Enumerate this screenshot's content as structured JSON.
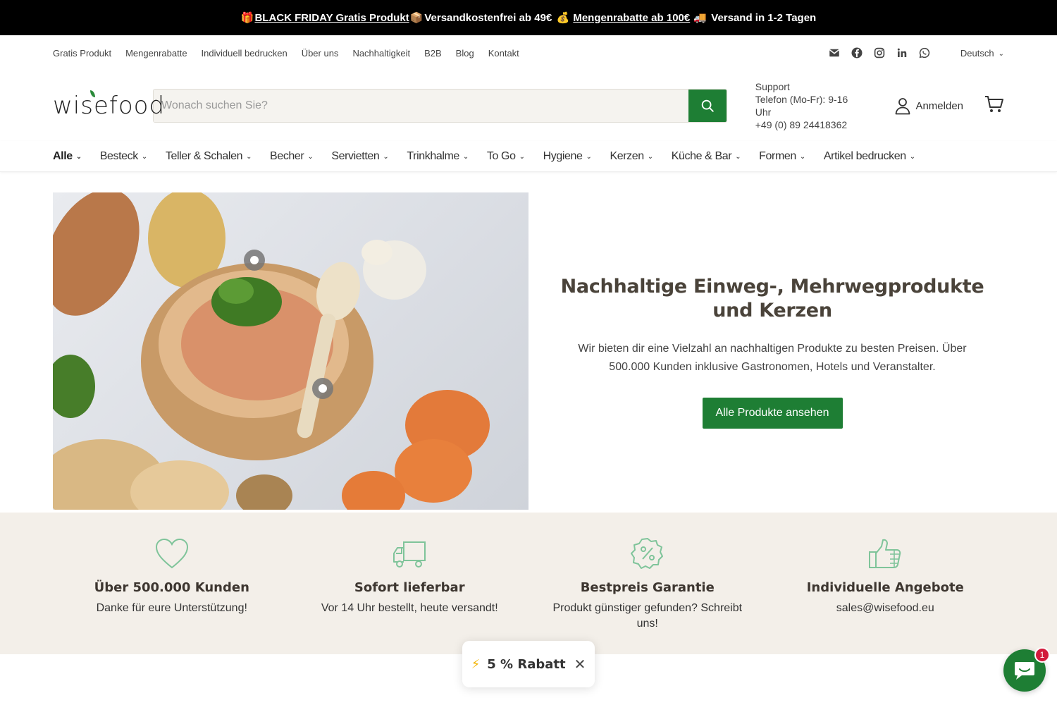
{
  "announcement": {
    "gift_emoji": "🎁",
    "black_friday": "BLACK FRIDAY Gratis Produkt",
    "box_emoji": "📦",
    "shipping_free": "Versandkostenfrei ab 49€",
    "money_emoji": "💰",
    "bulk": "Mengenrabatte ab 100€",
    "truck_emoji": "🚚",
    "delivery": "Versand in 1-2 Tagen"
  },
  "utility": {
    "links": [
      "Gratis Produkt",
      "Mengenrabatte",
      "Individuell bedrucken",
      "Über uns",
      "Nachhaltigkeit",
      "B2B",
      "Blog",
      "Kontakt"
    ],
    "social_icons": [
      "mail-icon",
      "facebook-icon",
      "instagram-icon",
      "linkedin-icon",
      "whatsapp-icon"
    ],
    "language": "Deutsch"
  },
  "header": {
    "logo": "wisefood",
    "search_placeholder": "Wonach suchen Sie?",
    "support_title": "Support",
    "support_hours": "Telefon (Mo-Fr): 9-16 Uhr",
    "support_phone": "+49 (0) 89 24418362",
    "login": "Anmelden"
  },
  "nav": [
    "Alle",
    "Besteck",
    "Teller & Schalen",
    "Becher",
    "Servietten",
    "Trinkhalme",
    "To Go",
    "Hygiene",
    "Kerzen",
    "Küche & Bar",
    "Formen",
    "Artikel bedrucken"
  ],
  "hero": {
    "title": "Nachhaltige Einweg-, Mehrwegprodukte und Kerzen",
    "text": "Wir bieten dir eine Vielzahl an nachhaltigen Produkte zu besten Preisen. Über 500.000 Kunden inklusive Gastronomen, Hotels und Veranstalter.",
    "button": "Alle Produkte ansehen"
  },
  "features": [
    {
      "icon": "heart-icon",
      "title": "Über 500.000 Kunden",
      "text": "Danke für eure Unterstützung!"
    },
    {
      "icon": "truck-icon",
      "title": "Sofort lieferbar",
      "text": "Vor 14 Uhr bestellt, heute versandt!"
    },
    {
      "icon": "percent-badge-icon",
      "title": "Bestpreis Garantie",
      "text": "Produkt günstiger gefunden? Schreibt uns!"
    },
    {
      "icon": "thumbs-up-icon",
      "title": "Individuelle Angebote",
      "text": "sales@wisefood.eu"
    }
  ],
  "promo": {
    "bolt": "⚡",
    "label": "5 % Rabatt",
    "close": "✕"
  },
  "chat": {
    "badge": "1"
  },
  "colors": {
    "brand_green": "#1e7e34",
    "feature_bg": "#f3efe9",
    "icon_green": "#7fc49a"
  }
}
